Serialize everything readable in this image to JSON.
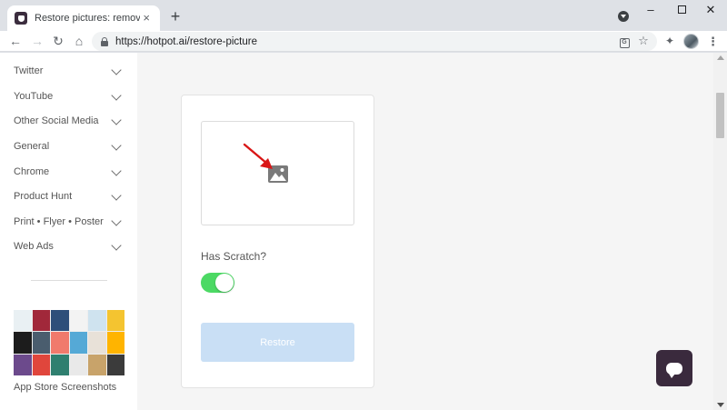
{
  "browser": {
    "tab_title": "Restore pictures: remove scratches",
    "tab_close": "×",
    "new_tab": "+",
    "url": "https://hotpot.ai/restore-picture",
    "window_minimize": "–",
    "window_close": "✕",
    "nav_back": "←",
    "nav_forward": "→",
    "nav_reload": "↻",
    "nav_home": "⌂",
    "translate_glyph": "G",
    "star_glyph": "☆",
    "extensions_glyph": "✦",
    "menu_glyph": "⋮"
  },
  "sidebar": {
    "items": [
      {
        "label": "Twitter"
      },
      {
        "label": "YouTube"
      },
      {
        "label": "Other Social Media"
      },
      {
        "label": "General"
      },
      {
        "label": "Chrome"
      },
      {
        "label": "Product Hunt"
      },
      {
        "label": "Print • Flyer • Poster"
      },
      {
        "label": "Web Ads"
      }
    ],
    "thumbnail_caption": "App Store Screenshots",
    "thumbnail_colors": [
      "#e9f0f3",
      "#a1283a",
      "#2e4f7a",
      "#f3f3f3",
      "#cfe3ef",
      "#f4c430",
      "#1c1c1c",
      "#4a5d6e",
      "#f07a6c",
      "#55a9d6",
      "#e8e1d8",
      "#ffb400",
      "#6c4a8c",
      "#e0463c",
      "#2f7f6f",
      "#e9e9e9",
      "#c8a36a",
      "#3b3b3b"
    ]
  },
  "main": {
    "has_scratch_label": "Has Scratch?",
    "has_scratch_enabled": true,
    "restore_button_label": "Restore"
  },
  "colors": {
    "toggle_on": "#4cd964",
    "restore_disabled": "#c9dff5",
    "chat_button": "#3a2a3d",
    "annotation_arrow": "#d91616"
  }
}
